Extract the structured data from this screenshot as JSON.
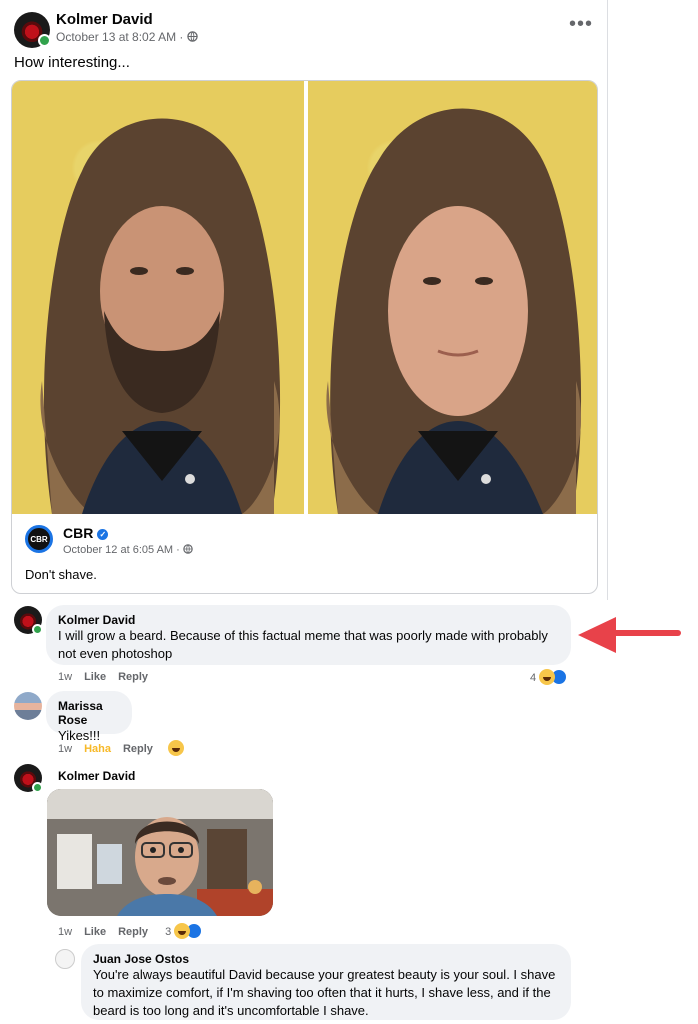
{
  "post": {
    "author": "Kolmer David",
    "time": "October 13 at 8:02 AM",
    "audience_icon": "globe-icon",
    "text": "How interesting...",
    "menu_icon": "more-dots-icon"
  },
  "shared": {
    "page_name": "CBR",
    "logo_text": "CBR",
    "time": "October 12 at 6:05 AM",
    "text": "Don't shave."
  },
  "comments": [
    {
      "author": "Kolmer David",
      "text": "I will grow a beard. Because of this factual meme that was poorly made with probably not even photoshop",
      "time": "1w",
      "like": "Like",
      "reply": "Reply",
      "reaction_count": "4"
    },
    {
      "author": "Marissa Rose",
      "text": "Yikes!!!",
      "time": "1w",
      "like": "Haha",
      "reply": "Reply"
    },
    {
      "author": "Kolmer David",
      "time": "1w",
      "like": "Like",
      "reply": "Reply",
      "reaction_count": "3"
    }
  ],
  "reply": {
    "author": "Juan Jose Ostos",
    "text": "You're always beautiful David because your greatest beauty is your soul. I shave to maximize comfort, if I'm shaving too often that it hurts, I shave less, and if the beard is too long and it's uncomfortable I shave."
  },
  "colors": {
    "accent": "#1b74e4",
    "online": "#31a24c",
    "haha": "#f7b928",
    "arrow": "#e8424a"
  }
}
